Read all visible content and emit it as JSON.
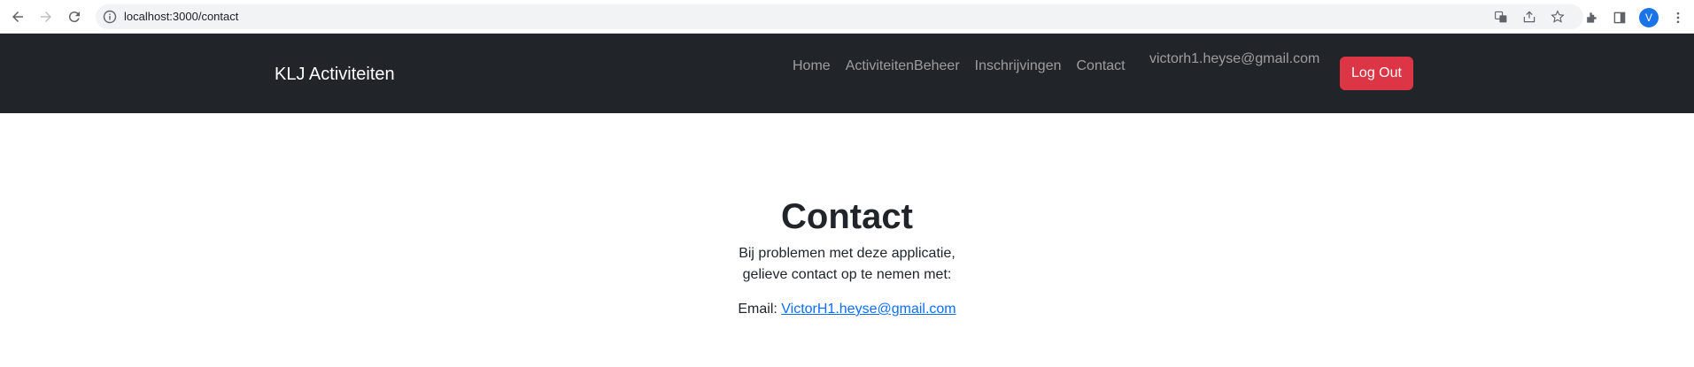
{
  "browser": {
    "url": "localhost:3000/contact",
    "avatar_letter": "V"
  },
  "navbar": {
    "brand": "KLJ Activiteiten",
    "links": [
      "Home",
      "ActiviteitenBeheer",
      "Inschrijvingen",
      "Contact"
    ],
    "user_email": "victorh1.heyse@gmail.com",
    "logout_label": "Log Out"
  },
  "main": {
    "title": "Contact",
    "description_line1": "Bij problemen met deze applicatie,",
    "description_line2": "gelieve contact op te nemen met:",
    "email_label": "Email:",
    "email_link": "VictorH1.heyse@gmail.com"
  },
  "colors": {
    "navbar_bg": "#212529",
    "logout_bg": "#dc3545",
    "link": "#0d6efd"
  }
}
